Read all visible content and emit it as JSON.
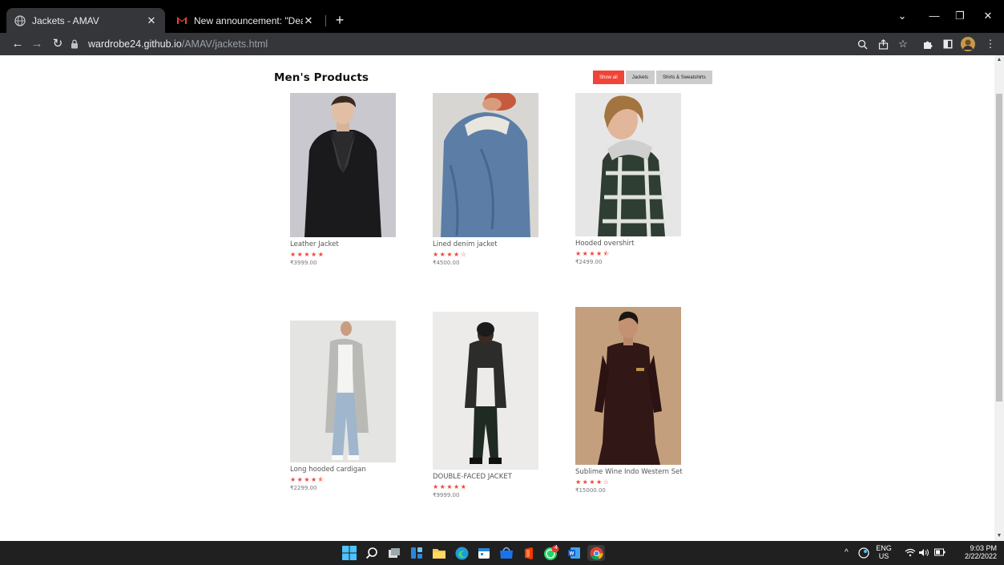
{
  "browser": {
    "tabs": [
      {
        "title": "Jackets - AMAV",
        "active": true
      },
      {
        "title": "New announcement: \"Dear stude",
        "active": false
      }
    ],
    "url_host": "wardrobe24.github.io",
    "url_path": "/AMAV/jackets.html"
  },
  "page": {
    "title": "Men's Products",
    "filters": [
      "Show all",
      "Jackets",
      "Shirts & Sweatshirts"
    ],
    "active_filter": "Show all",
    "accent_color": "#f04438"
  },
  "products": [
    {
      "name": "Leather Jacket",
      "stars": "★★★★★",
      "rating": 5,
      "price": "₹3999.00"
    },
    {
      "name": "Lined denim jacket",
      "stars": "★★★★☆",
      "rating": 4,
      "price": "₹4500.00"
    },
    {
      "name": "Hooded overshirt",
      "stars": "★★★★⯪",
      "rating": 4.5,
      "price": "₹2499.00"
    },
    {
      "name": "Long hooded cardigan",
      "stars": "★★★★⯪",
      "rating": 4.5,
      "price": "₹2299.00"
    },
    {
      "name": "DOUBLE-FACED JACKET",
      "stars": "★★★★★",
      "rating": 5,
      "price": "₹9999.00"
    },
    {
      "name": "Sublime Wine Indo Western Set",
      "stars": "★★★★☆",
      "rating": 4,
      "price": "₹15000.00"
    }
  ],
  "taskbar": {
    "language": "ENG",
    "region": "US",
    "time": "9:03 PM",
    "date": "2/22/2022",
    "whatsapp_badge": "4"
  }
}
